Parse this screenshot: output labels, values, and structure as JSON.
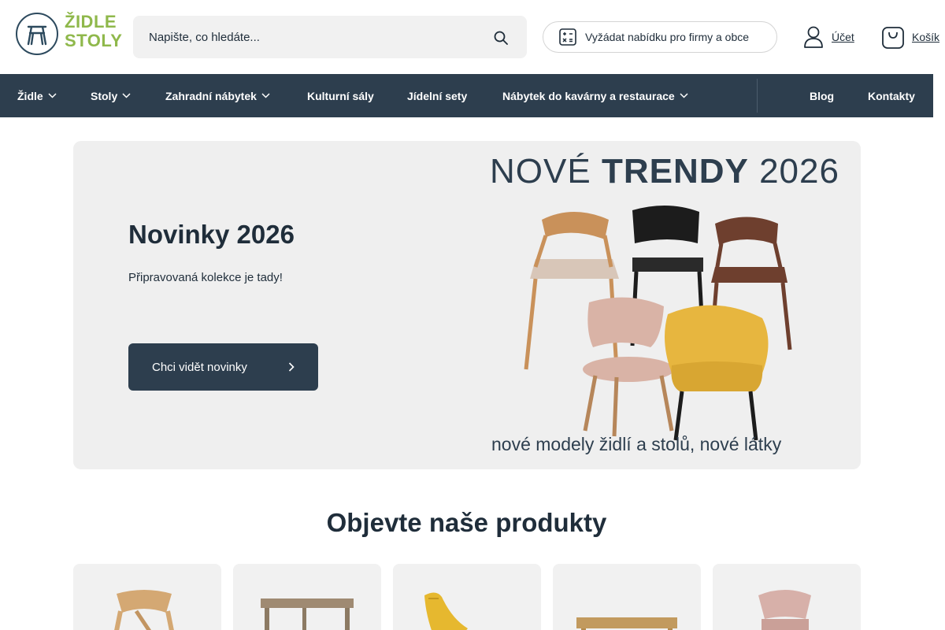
{
  "header": {
    "logo_line1": "ŽIDLE",
    "logo_line2": "STOLY",
    "search": {
      "placeholder": "Napište, co hledáte..."
    },
    "offer_label": "Vyžádat nabídku pro firmy a obce",
    "account_label": "Účet",
    "cart_label": "Košík"
  },
  "nav": {
    "items": [
      {
        "label": "Židle",
        "has_dropdown": true
      },
      {
        "label": "Stoly",
        "has_dropdown": true
      },
      {
        "label": "Zahradní nábytek",
        "has_dropdown": true
      },
      {
        "label": "Kulturní sály",
        "has_dropdown": false
      },
      {
        "label": "Jídelní sety",
        "has_dropdown": false
      },
      {
        "label": "Nábytek do kavárny a restaurace",
        "has_dropdown": true
      },
      {
        "label": "Blog",
        "has_dropdown": false
      },
      {
        "label": "Kontakty",
        "has_dropdown": false
      }
    ]
  },
  "hero": {
    "title": "Novinky 2026",
    "subtitle": "Připravovaná kolekce je tady!",
    "button_label": "Chci vidět novinky",
    "image_heading_light": "NOVÉ",
    "image_heading_bold": "TRENDY",
    "image_heading_year": "2026",
    "image_footer": "nové modely židlí a stolů, nové látky"
  },
  "products": {
    "title": "Objevte naše produkty",
    "cards": [
      {
        "name": "oak-chair"
      },
      {
        "name": "wooden-table"
      },
      {
        "name": "yellow-chair"
      },
      {
        "name": "oak-table"
      },
      {
        "name": "pink-chair"
      }
    ]
  },
  "colors": {
    "brand_dark": "#2d3e4e",
    "brand_green": "#8fb84b",
    "hero_bg": "#efefef"
  }
}
